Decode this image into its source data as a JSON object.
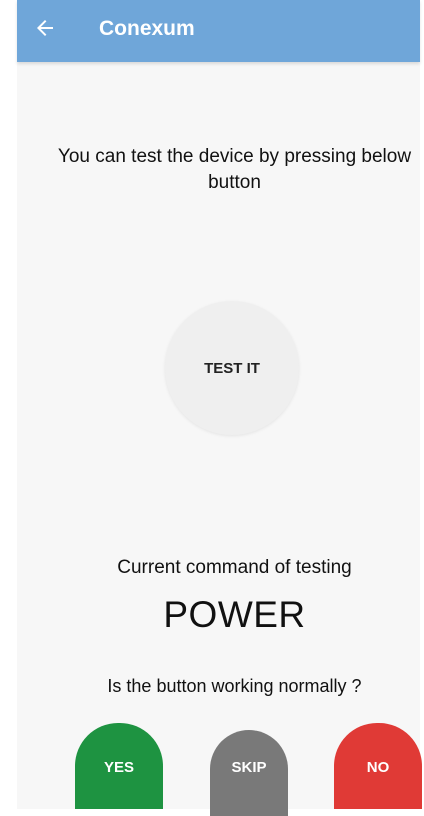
{
  "appbar": {
    "title": "Conexum",
    "back_icon": "arrow-left-icon",
    "color": "#6fa6d9"
  },
  "instruction": {
    "text": "You can test the device by pressing below button"
  },
  "test_button": {
    "label": "TEST IT"
  },
  "command": {
    "label": "Current command of testing",
    "value": "POWER"
  },
  "question": {
    "text": "Is the button working normally ?"
  },
  "actions": {
    "yes": {
      "label": "YES",
      "color": "#1e9341"
    },
    "skip": {
      "label": "SKIP",
      "color": "#797979"
    },
    "no": {
      "label": "NO",
      "color": "#e03a36"
    }
  }
}
